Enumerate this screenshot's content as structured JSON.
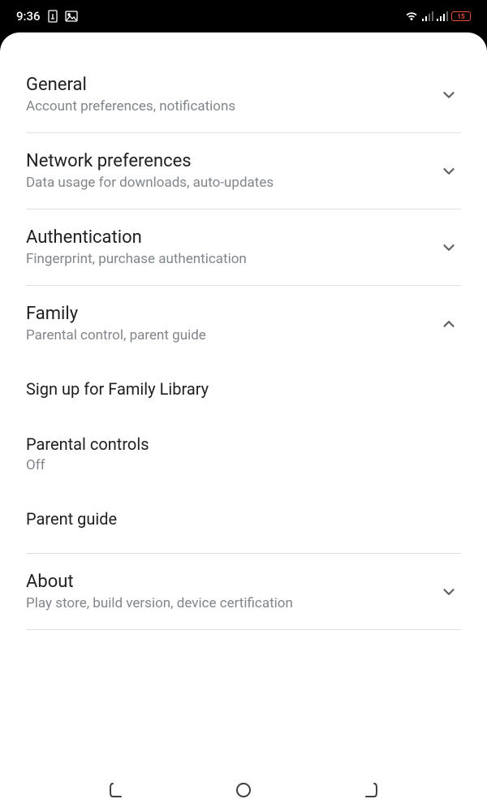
{
  "status_bar": {
    "time": "9:36",
    "battery_text": "15"
  },
  "sections": {
    "general": {
      "title": "General",
      "subtitle": "Account preferences, notifications"
    },
    "network": {
      "title": "Network preferences",
      "subtitle": "Data usage for downloads, auto-updates"
    },
    "auth": {
      "title": "Authentication",
      "subtitle": "Fingerprint, purchase authentication"
    },
    "family": {
      "title": "Family",
      "subtitle": "Parental control, parent guide"
    },
    "about": {
      "title": "About",
      "subtitle": "Play store, build version, device certification"
    }
  },
  "family_expanded": {
    "signup": {
      "title": "Sign up for Family Library"
    },
    "parental_controls": {
      "title": "Parental controls",
      "value": "Off"
    },
    "parent_guide": {
      "title": "Parent guide"
    }
  }
}
